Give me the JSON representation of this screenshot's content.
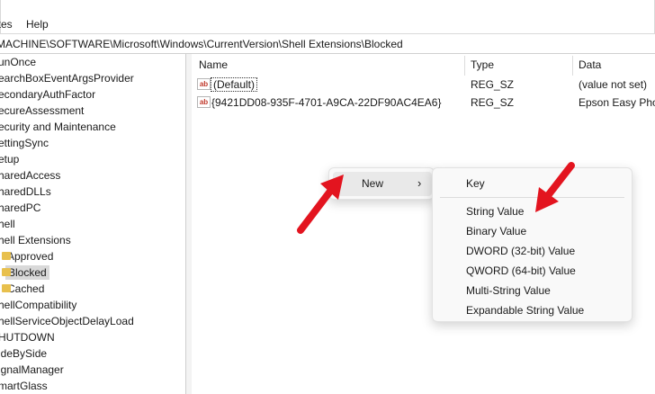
{
  "menubar": {
    "items": [
      "ites",
      "Help"
    ]
  },
  "address": {
    "path": "MACHINE\\SOFTWARE\\Microsoft\\Windows\\CurrentVersion\\Shell Extensions\\Blocked"
  },
  "tree": {
    "items": [
      "unOnce",
      "earchBoxEventArgsProvider",
      "econdaryAuthFactor",
      "ecureAssessment",
      "ecurity and Maintenance",
      "ettingSync",
      "etup",
      "haredAccess",
      "haredDLLs",
      "haredPC",
      "hell",
      "hell Extensions",
      "Approved",
      "Blocked",
      "Cached",
      "hellCompatibility",
      "hellServiceObjectDelayLoad",
      "HUTDOWN",
      "ideBySide",
      "ignalManager",
      "martGlass"
    ]
  },
  "list": {
    "headers": [
      "Name",
      "Type",
      "Data"
    ],
    "rows": [
      {
        "name": "(Default)",
        "type": "REG_SZ",
        "data": "(value not set)",
        "icon": "ab-string-icon"
      },
      {
        "name": "{9421DD08-935F-4701-A9CA-22DF90AC4EA6}",
        "type": "REG_SZ",
        "data": "Epson Easy Phot",
        "icon": "ab-string-icon"
      }
    ]
  },
  "context_menu": {
    "new_label": "New",
    "submenu": [
      "Key",
      "String Value",
      "Binary Value",
      "DWORD (32-bit) Value",
      "QWORD (64-bit) Value",
      "Multi-String Value",
      "Expandable String Value"
    ]
  },
  "colors": {
    "arrow": "#e3141f",
    "folder": "#e8c04d",
    "selection": "#d9d9d9"
  }
}
